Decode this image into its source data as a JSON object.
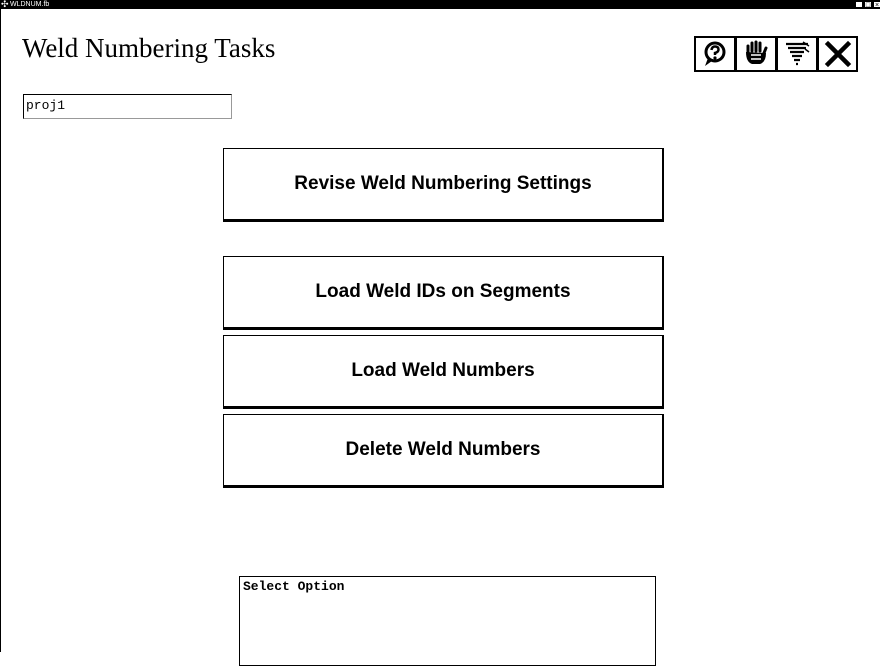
{
  "window": {
    "title": "WLDNUM.fb",
    "controls": [
      "_",
      "□",
      "×"
    ]
  },
  "header": {
    "title": "Weld Numbering Tasks"
  },
  "toolbar": {
    "icons": [
      "help-icon",
      "hand-icon",
      "tornado-icon",
      "close-icon"
    ]
  },
  "project": {
    "value": "proj1"
  },
  "tasks": [
    {
      "label": "Revise Weld Numbering Settings"
    },
    {
      "label": "Load Weld IDs on Segments"
    },
    {
      "label": "Load Weld Numbers"
    },
    {
      "label": "Delete Weld Numbers"
    }
  ],
  "status": {
    "text": "Select Option"
  }
}
